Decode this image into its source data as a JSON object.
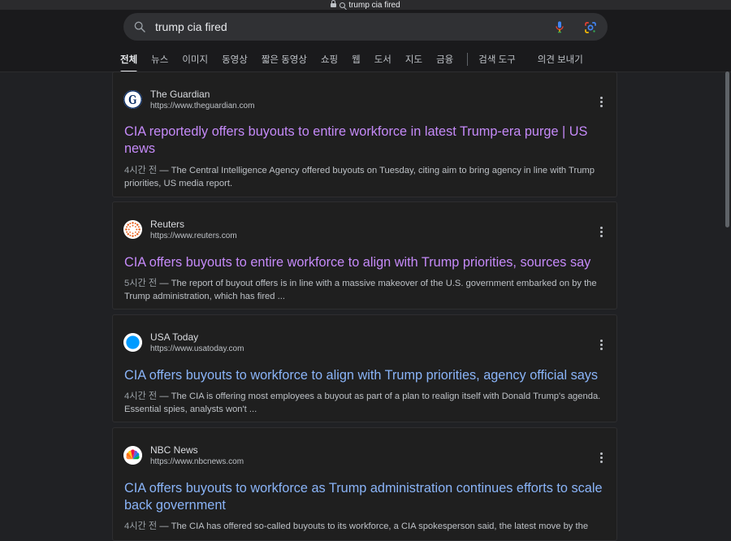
{
  "browser": {
    "url_text": "trump cia fired"
  },
  "search": {
    "query": "trump cia fired"
  },
  "tabs": [
    {
      "label": "전체",
      "active": true
    },
    {
      "label": "뉴스"
    },
    {
      "label": "이미지"
    },
    {
      "label": "동영상"
    },
    {
      "label": "짧은 동영상"
    },
    {
      "label": "쇼핑"
    },
    {
      "label": "웹"
    },
    {
      "label": "도서"
    },
    {
      "label": "지도"
    },
    {
      "label": "금융"
    }
  ],
  "tools": {
    "search_tools": "검색 도구",
    "feedback": "의견 보내기"
  },
  "results": [
    {
      "site": "The Guardian",
      "url": "https://www.theguardian.com",
      "title": "CIA reportedly offers buyouts to entire workforce in latest Trump-era purge | US news",
      "date": "4시간 전",
      "snippet": " — The Central Intelligence Agency offered buyouts on Tuesday, citing aim to bring agency in line with Trump priorities, US media report.",
      "visited": true
    },
    {
      "site": "Reuters",
      "url": "https://www.reuters.com",
      "title": "CIA offers buyouts to entire workforce to align with Trump priorities, sources say",
      "date": "5시간 전",
      "snippet": " — The report of buyout offers is in line with a massive makeover of the U.S. government embarked on by the Trump administration, which has fired ...",
      "visited": true
    },
    {
      "site": "USA Today",
      "url": "https://www.usatoday.com",
      "title": "CIA offers buyouts to workforce to align with Trump priorities, agency official says",
      "date": "4시간 전",
      "snippet": " — The CIA is offering most employees a buyout as part of a plan to realign itself with Donald Trump's agenda. Essential spies, analysts won't ...",
      "visited": false
    },
    {
      "site": "NBC News",
      "url": "https://www.nbcnews.com",
      "title": "CIA offers buyouts to workforce as Trump administration continues efforts to scale back government",
      "date": "4시간 전",
      "snippet": " — The CIA has offered so-called buyouts to its workforce, a CIA spokesperson said, the latest move by the",
      "visited": false
    }
  ],
  "colors": {
    "visited_link": "#c58af9",
    "link": "#8ab4f8",
    "background": "#202124"
  }
}
